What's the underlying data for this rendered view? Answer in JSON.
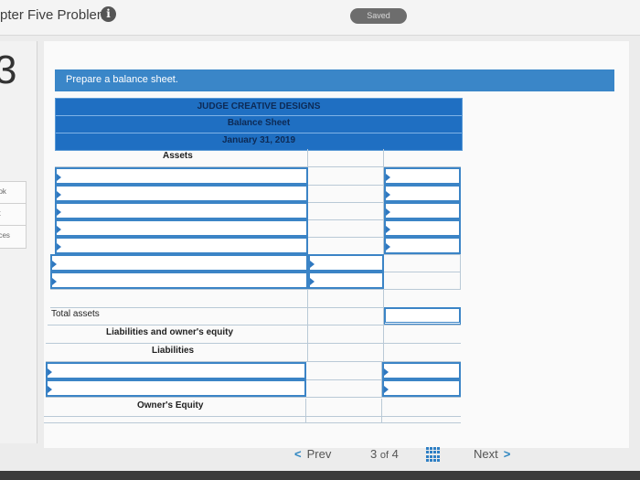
{
  "header": {
    "title": "pter Five Problems",
    "info_icon": "i",
    "status": "Saved"
  },
  "sidebar": {
    "question_number": "3",
    "tabs": [
      "ook",
      "nt",
      "nces"
    ]
  },
  "question": {
    "prompt": "Prepare a balance sheet.",
    "company": "JUDGE CREATIVE DESIGNS",
    "statement": "Balance Sheet",
    "date": "January 31, 2019"
  },
  "sheet": {
    "assets_heading": "Assets",
    "total_assets": "Total assets",
    "liab_equity_heading": "Liabilities and owner's equity",
    "liabilities_heading": "Liabilities",
    "equity_heading": "Owner's Equity"
  },
  "nav": {
    "prev": "Prev",
    "current": "3",
    "of": "of",
    "total": "4",
    "next": "Next"
  }
}
